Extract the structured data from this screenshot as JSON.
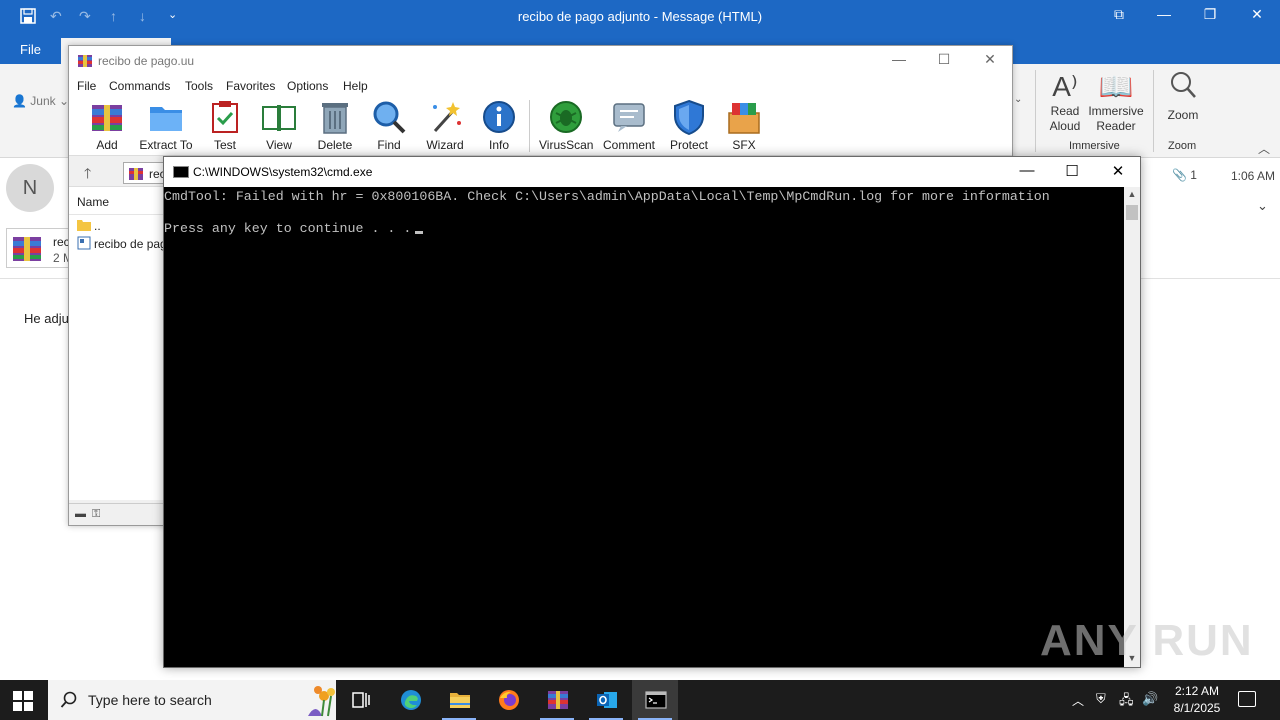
{
  "outlook": {
    "title": "recibo de pago adjunto  -  Message (HTML)",
    "file_tab": "File",
    "junk": "Junk",
    "ribbon": {
      "read_aloud": [
        "Read",
        "Aloud"
      ],
      "immersive_reader": [
        "Immersive",
        "Reader"
      ],
      "immersive_group": "Immersive",
      "zoom": "Zoom",
      "zoom_group": "Zoom"
    },
    "sender_initial": "N",
    "attachment": {
      "name": "reci",
      "size": "2 M"
    },
    "attachment_count": "1",
    "time": "1:06 AM",
    "body_text": "He adju"
  },
  "winrar": {
    "title": "recibo de pago.uu",
    "menu": [
      "File",
      "Commands",
      "Tools",
      "Favorites",
      "Options",
      "Help"
    ],
    "toolbar": [
      "Add",
      "Extract To",
      "Test",
      "View",
      "Delete",
      "Find",
      "Wizard",
      "Info",
      "VirusScan",
      "Comment",
      "Protect",
      "SFX"
    ],
    "address": "rec",
    "column_name": "Name",
    "rows": [
      "..",
      "recibo de pag"
    ]
  },
  "cmd": {
    "title": "C:\\WINDOWS\\system32\\cmd.exe",
    "lines": [
      "CmdTool: Failed with hr = 0x800106BA. Check C:\\Users\\admin\\AppData\\Local\\Temp\\MpCmdRun.log for more information",
      "",
      "Press any key to continue . . ."
    ]
  },
  "watermark": "ANY RUN",
  "taskbar": {
    "search_placeholder": "Type here to search",
    "time": "2:12 AM",
    "date": "8/1/2025"
  },
  "colors": {
    "outlook_blue": "#1d68c4",
    "taskbar": "#1c1c1c",
    "cmd_bg": "#000000",
    "cmd_text": "#c0c0c0"
  }
}
